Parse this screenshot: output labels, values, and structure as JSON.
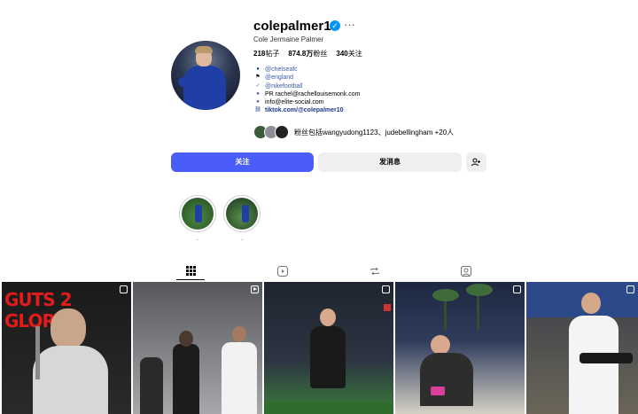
{
  "profile": {
    "username": "colepalmer10",
    "full_name": "Cole Jermaine Palmer",
    "more_icon": "more-icon",
    "verified_icon": "verified-icon",
    "stats": {
      "posts_num": "218",
      "posts_label": "帖子",
      "followers_num": "874.8万",
      "followers_label": "粉丝",
      "following_num": "340",
      "following_label": "关注"
    },
    "bio": {
      "chelsea": "@chelseafc",
      "england": "@england",
      "nike": "@nikefootball",
      "pr": "PR rachel@rachellouisemonk.com",
      "info": "info@elite-social.com",
      "link": "tiktok.com/@colepalmer10"
    },
    "followed_by": "粉丝包括wangyudong1123、judebellingham +20人"
  },
  "actions": {
    "follow": "关注",
    "message": "发消息",
    "add_icon": "add-person-icon"
  },
  "highlights": [
    {
      "label": "."
    },
    {
      "label": "."
    }
  ],
  "tabs": [
    {
      "icon": "grid-icon",
      "active": true
    },
    {
      "icon": "reels-icon",
      "active": false
    },
    {
      "icon": "reposts-icon",
      "active": false
    },
    {
      "icon": "tagged-icon",
      "active": false
    }
  ],
  "posts": {
    "first_title": "GUTS 2 GLORY"
  }
}
